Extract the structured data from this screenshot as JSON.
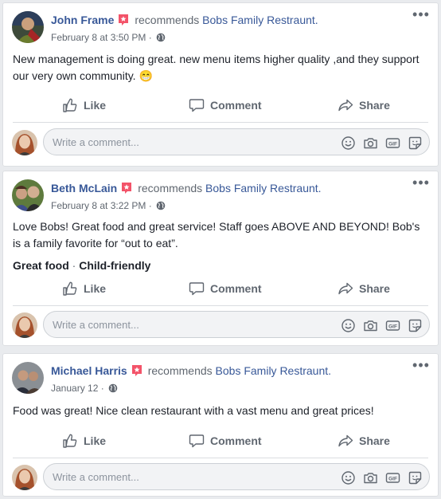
{
  "posts": [
    {
      "author": "John Frame",
      "recommends_text": "recommends",
      "page_name": "Bobs Family Restraunt.",
      "timestamp": "February 8 at 3:50 PM",
      "separator": "·",
      "text": "New management is doing great. new menu items higher quality ,and they support our very own community. 😁",
      "tags": []
    },
    {
      "author": "Beth McLain",
      "recommends_text": "recommends",
      "page_name": "Bobs Family Restraunt.",
      "timestamp": "February 8 at 3:22 PM",
      "separator": "·",
      "text": "Love Bobs! Great food and great service! Staff goes ABOVE AND BEYOND! Bob's is a family favorite for “out to eat”.",
      "tags": [
        "Great food",
        "Child-friendly"
      ]
    },
    {
      "author": "Michael Harris",
      "recommends_text": "recommends",
      "page_name": "Bobs Family Restraunt.",
      "timestamp": "January 12",
      "separator": "·",
      "text": "Food was great! Nice clean restaurant with a vast menu and great prices!",
      "tags": []
    }
  ],
  "actions": {
    "like": "Like",
    "comment": "Comment",
    "share": "Share"
  },
  "comment_box": {
    "placeholder": "Write a comment..."
  },
  "icons": {
    "more": "more-options-icon",
    "audience": "globe-icon",
    "badge": "recommendation-badge-icon",
    "like": "thumbs-up-icon",
    "comment": "speech-bubble-icon",
    "share": "share-arrow-icon",
    "emoji": "emoji-icon",
    "camera": "camera-icon",
    "gif": "gif-icon",
    "sticker": "sticker-icon"
  },
  "colors": {
    "link": "#385898",
    "secondary_text": "#606770",
    "badge": "#f35369",
    "background": "#e9ebee"
  }
}
